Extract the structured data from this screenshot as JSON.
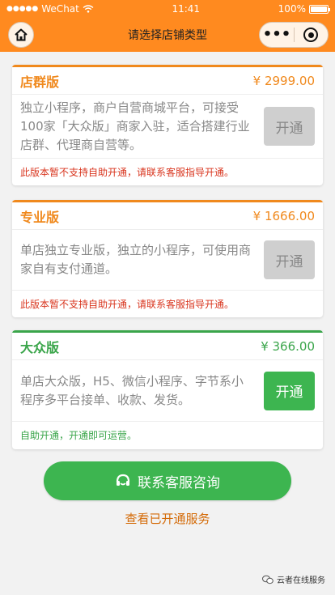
{
  "status_bar": {
    "carrier": "WeChat",
    "time": "11:41",
    "battery": "100%"
  },
  "nav": {
    "title": "请选择店铺类型"
  },
  "plans": [
    {
      "name": "店群版",
      "price": "¥ 2999.00",
      "description": "独立小程序，商户自营商城平台，可接受100家「大众版」商家入驻，适合搭建行业店群、代理商自营等。",
      "button": "开通",
      "button_enabled": false,
      "note": "此版本暂不支持自助开通，请联系客服指导开通。",
      "accent_color": "#f0891d",
      "note_color": "#d9361f"
    },
    {
      "name": "专业版",
      "price": "¥ 1666.00",
      "description": "单店独立专业版，独立的小程序，可使用商家自有支付通道。",
      "button": "开通",
      "button_enabled": false,
      "note": "此版本暂不支持自助开通，请联系客服指导开通。",
      "accent_color": "#f0891d",
      "note_color": "#d9361f"
    },
    {
      "name": "大众版",
      "price": "¥ 366.00",
      "description": "单店大众版，H5、微信小程序、字节系小程序多平台接单、收款、发货。",
      "button": "开通",
      "button_enabled": true,
      "note": "自助开通，开通即可运营。",
      "accent_color": "#3aa54a",
      "note_color": "#3aa54a"
    }
  ],
  "contact_button": "联系客服咨询",
  "view_services_link": "查看已开通服务",
  "watermark": "云者在线服务",
  "colors": {
    "brand_orange": "#ff8a1f",
    "green": "#3db550"
  }
}
